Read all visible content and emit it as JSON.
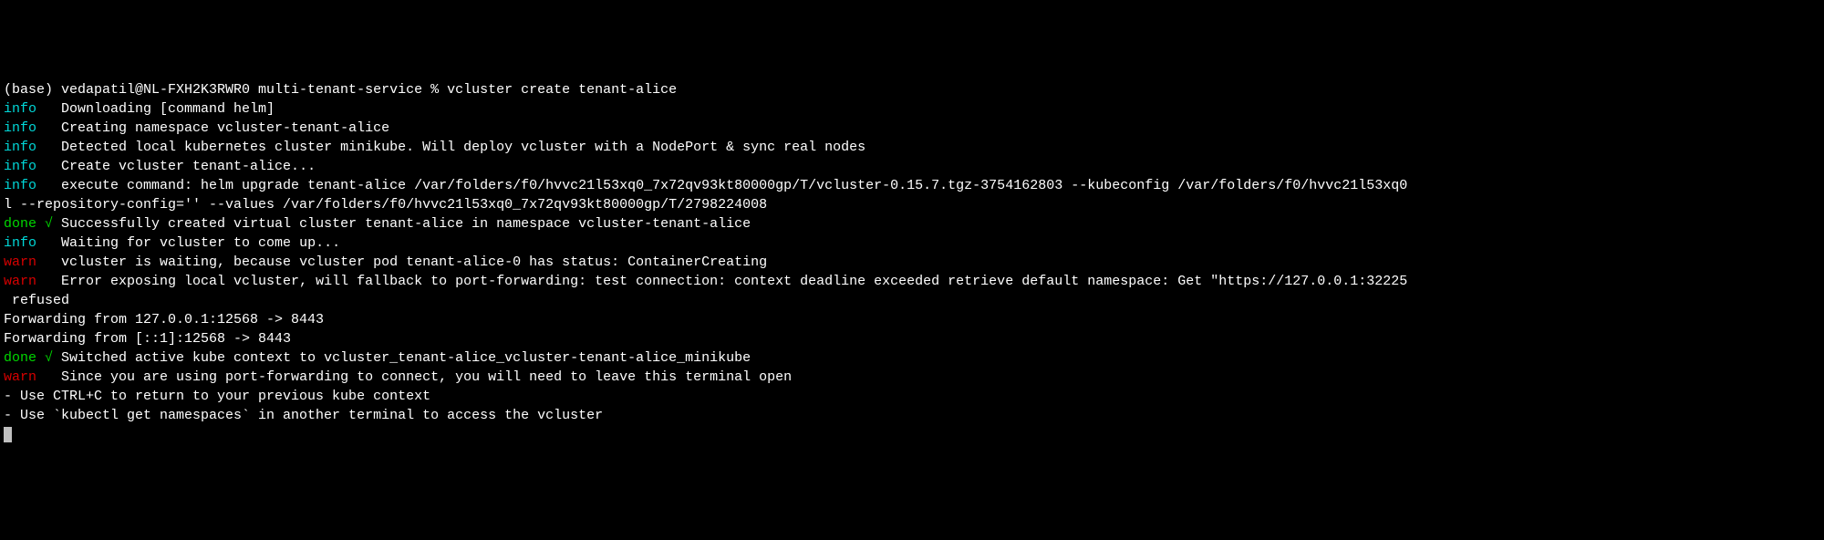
{
  "lines": [
    {
      "prefix": "",
      "prefixClass": "",
      "text": "(base) vedapatil@NL-FXH2K3RWR0 multi-tenant-service % vcluster create tenant-alice"
    },
    {
      "prefix": "info",
      "prefixClass": "info",
      "text": "   Downloading [command helm]"
    },
    {
      "prefix": "info",
      "prefixClass": "info",
      "text": "   Creating namespace vcluster-tenant-alice"
    },
    {
      "prefix": "info",
      "prefixClass": "info",
      "text": "   Detected local kubernetes cluster minikube. Will deploy vcluster with a NodePort & sync real nodes"
    },
    {
      "prefix": "info",
      "prefixClass": "info",
      "text": "   Create vcluster tenant-alice..."
    },
    {
      "prefix": "info",
      "prefixClass": "info",
      "text": "   execute command: helm upgrade tenant-alice /var/folders/f0/hvvc21l53xq0_7x72qv93kt80000gp/T/vcluster-0.15.7.tgz-3754162803 --kubeconfig /var/folders/f0/hvvc21l53xq0"
    },
    {
      "prefix": "",
      "prefixClass": "",
      "text": "l --repository-config='' --values /var/folders/f0/hvvc21l53xq0_7x72qv93kt80000gp/T/2798224008"
    },
    {
      "prefix": "done",
      "prefixClass": "done",
      "check": " √ ",
      "text": "Successfully created virtual cluster tenant-alice in namespace vcluster-tenant-alice"
    },
    {
      "prefix": "info",
      "prefixClass": "info",
      "text": "   Waiting for vcluster to come up..."
    },
    {
      "prefix": "warn",
      "prefixClass": "warn",
      "text": "   vcluster is waiting, because vcluster pod tenant-alice-0 has status: ContainerCreating"
    },
    {
      "prefix": "warn",
      "prefixClass": "warn",
      "text": "   Error exposing local vcluster, will fallback to port-forwarding: test connection: context deadline exceeded retrieve default namespace: Get \"https://127.0.0.1:32225"
    },
    {
      "prefix": "",
      "prefixClass": "",
      "text": " refused"
    },
    {
      "prefix": "",
      "prefixClass": "",
      "text": "Forwarding from 127.0.0.1:12568 -> 8443"
    },
    {
      "prefix": "",
      "prefixClass": "",
      "text": "Forwarding from [::1]:12568 -> 8443"
    },
    {
      "prefix": "done",
      "prefixClass": "done",
      "check": " √ ",
      "text": "Switched active kube context to vcluster_tenant-alice_vcluster-tenant-alice_minikube"
    },
    {
      "prefix": "warn",
      "prefixClass": "warn",
      "text": "   Since you are using port-forwarding to connect, you will need to leave this terminal open"
    },
    {
      "prefix": "",
      "prefixClass": "",
      "text": "- Use CTRL+C to return to your previous kube context"
    },
    {
      "prefix": "",
      "prefixClass": "",
      "text": "- Use `kubectl get namespaces` in another terminal to access the vcluster"
    }
  ]
}
